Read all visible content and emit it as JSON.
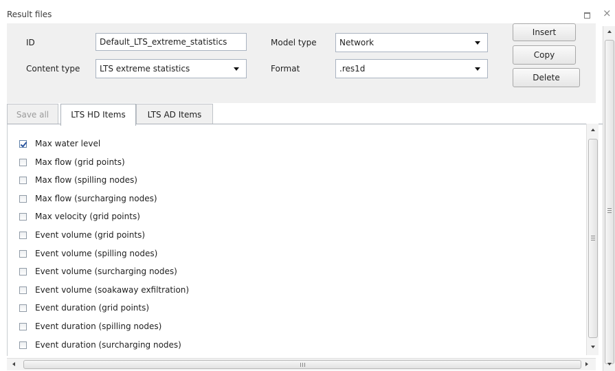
{
  "panel": {
    "title": "Result files"
  },
  "form": {
    "id_label": "ID",
    "id_value": "Default_LTS_extreme_statistics",
    "content_type_label": "Content type",
    "content_type_value": "LTS extreme statistics",
    "model_type_label": "Model type",
    "model_type_value": "Network",
    "format_label": "Format",
    "format_value": ".res1d"
  },
  "buttons": {
    "insert": "Insert",
    "copy": "Copy",
    "delete": "Delete"
  },
  "tabs": [
    {
      "label": "Save all",
      "state": "disabled"
    },
    {
      "label": "LTS HD Items",
      "state": "active"
    },
    {
      "label": "LTS AD Items",
      "state": "normal"
    }
  ],
  "items": [
    {
      "label": "Max water level",
      "checked": true
    },
    {
      "label": "Max flow (grid points)",
      "checked": false
    },
    {
      "label": "Max flow (spilling nodes)",
      "checked": false
    },
    {
      "label": "Max flow (surcharging nodes)",
      "checked": false
    },
    {
      "label": "Max velocity (grid points)",
      "checked": false
    },
    {
      "label": "Event volume (grid points)",
      "checked": false
    },
    {
      "label": "Event volume (spilling nodes)",
      "checked": false
    },
    {
      "label": "Event volume (surcharging nodes)",
      "checked": false
    },
    {
      "label": "Event volume (soakaway exfiltration)",
      "checked": false
    },
    {
      "label": "Event duration (grid points)",
      "checked": false
    },
    {
      "label": "Event duration (spilling nodes)",
      "checked": false
    },
    {
      "label": "Event duration (surcharging nodes)",
      "checked": false
    }
  ],
  "colors": {
    "panel_bg": "#f0f0f0",
    "check_blue": "#2b55a0"
  },
  "icons": {
    "restore": "restore-window-icon",
    "close": "close-icon"
  }
}
